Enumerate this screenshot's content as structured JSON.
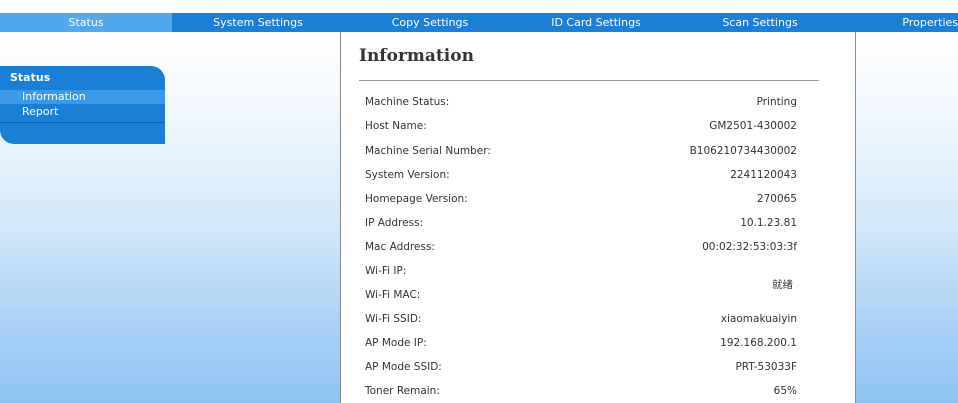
{
  "nav": {
    "tabs": [
      {
        "label": "Status"
      },
      {
        "label": "System Settings"
      },
      {
        "label": "Copy Settings"
      },
      {
        "label": "ID Card Settings"
      },
      {
        "label": "Scan Settings"
      },
      {
        "label": "Properties"
      }
    ]
  },
  "sidebar": {
    "heading": "Status",
    "items": [
      {
        "label": "Information"
      },
      {
        "label": "Report"
      }
    ]
  },
  "main": {
    "title": "Information",
    "rows": [
      {
        "label": "Machine Status:",
        "value": "Printing"
      },
      {
        "label": "Host Name:",
        "value": "GM2501-430002"
      },
      {
        "label": "Machine Serial Number:",
        "value": "B106210734430002"
      },
      {
        "label": "System Version:",
        "value": "2241120043"
      },
      {
        "label": "Homepage Version:",
        "value": "270065"
      },
      {
        "label": "IP Address:",
        "value": "10.1.23.81"
      },
      {
        "label": "Mac Address:",
        "value": "00:02:32:53:03:3f"
      },
      {
        "label": "Wi-Fi IP:",
        "value": ""
      },
      {
        "label": "Wi-Fi MAC:",
        "value": ""
      },
      {
        "label": "Wi-Fi SSID:",
        "value": "xiaomakuaiyin"
      },
      {
        "label": "AP Mode IP:",
        "value": "192.168.200.1"
      },
      {
        "label": "AP Mode SSID:",
        "value": "PRT-53033F"
      },
      {
        "label": "Toner Remain:",
        "value": "65%"
      }
    ],
    "wifi_status": "就绪"
  },
  "colors": {
    "nav_bar": "#1a7fd6",
    "nav_active": "#4fa8f0",
    "side_gradient_bottom": "#8ec4f1"
  }
}
